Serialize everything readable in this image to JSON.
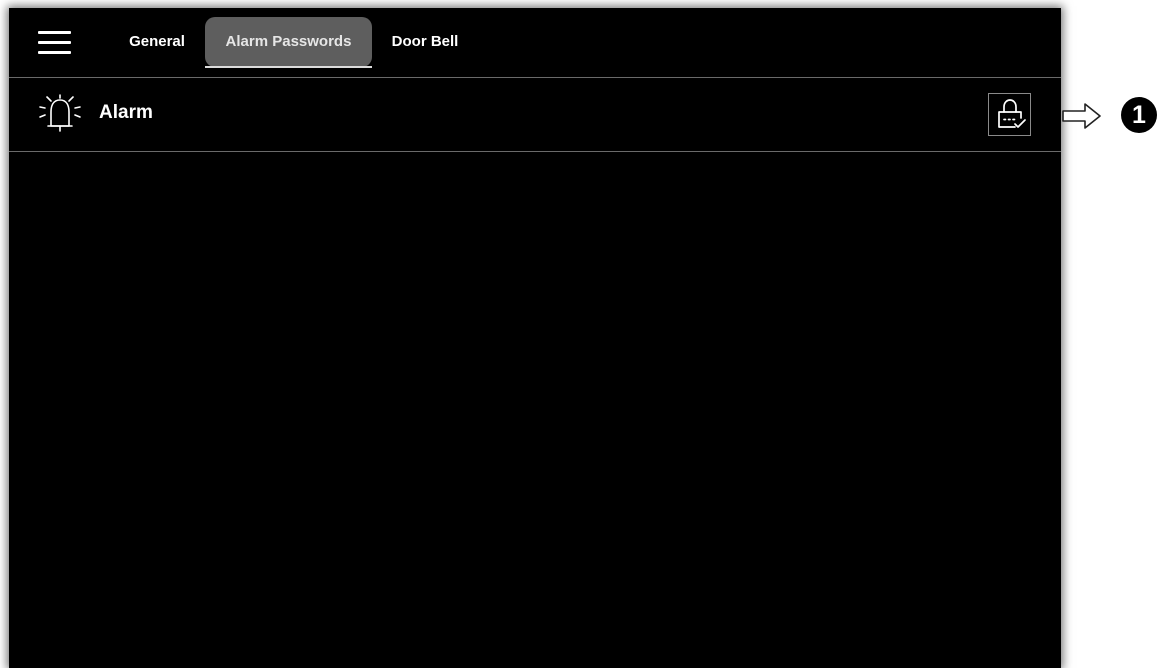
{
  "tabs": {
    "general": "General",
    "alarm_passwords": "Alarm Passwords",
    "door_bell": "Door Bell"
  },
  "active_tab": "Alarm Passwords",
  "row": {
    "label": "Alarm",
    "icon": "alarm-bell-icon",
    "action_icon": "lock-check-icon"
  },
  "callout": {
    "number": "1",
    "arrow_icon": "arrow-right-outline-icon"
  },
  "colors": {
    "screen_bg": "#000000",
    "active_tab_bg": "#5e5e5e",
    "divider": "#6a6a6a",
    "text": "#ffffff"
  }
}
